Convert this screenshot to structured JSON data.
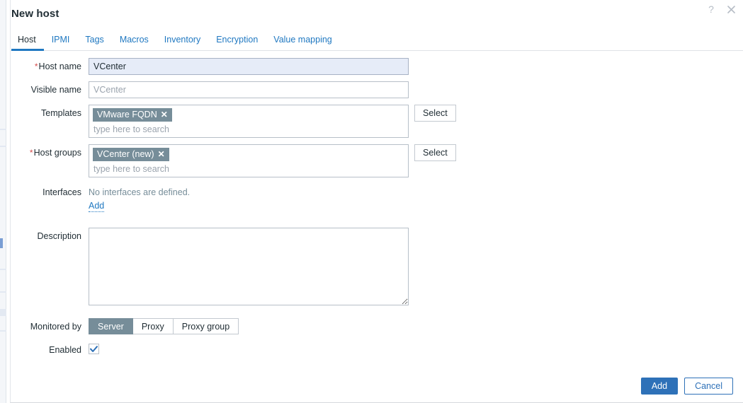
{
  "modal": {
    "title": "New host",
    "help_icon_label": "?",
    "close_icon_label": "×"
  },
  "tabs": [
    {
      "label": "Host",
      "active": true
    },
    {
      "label": "IPMI",
      "active": false
    },
    {
      "label": "Tags",
      "active": false
    },
    {
      "label": "Macros",
      "active": false
    },
    {
      "label": "Inventory",
      "active": false
    },
    {
      "label": "Encryption",
      "active": false
    },
    {
      "label": "Value mapping",
      "active": false
    }
  ],
  "form": {
    "host_name": {
      "label": "Host name",
      "required_marker": "*",
      "value": "VCenter"
    },
    "visible_name": {
      "label": "Visible name",
      "value": "",
      "placeholder": "VCenter"
    },
    "templates": {
      "label": "Templates",
      "chips": [
        {
          "text": "VMware FQDN",
          "remove": "✕"
        }
      ],
      "search_placeholder": "type here to search",
      "select_button": "Select"
    },
    "host_groups": {
      "label": "Host groups",
      "required_marker": "*",
      "chips": [
        {
          "text": "VCenter (new)",
          "remove": "✕"
        }
      ],
      "search_placeholder": "type here to search",
      "select_button": "Select"
    },
    "interfaces": {
      "label": "Interfaces",
      "empty_text": "No interfaces are defined.",
      "add_link": "Add"
    },
    "description": {
      "label": "Description",
      "value": "",
      "placeholder": ""
    },
    "monitored_by": {
      "label": "Monitored by",
      "options": [
        {
          "label": "Server",
          "selected": true
        },
        {
          "label": "Proxy",
          "selected": false
        },
        {
          "label": "Proxy group",
          "selected": false
        }
      ]
    },
    "enabled": {
      "label": "Enabled",
      "checked": true
    }
  },
  "footer": {
    "submit_label": "Add",
    "cancel_label": "Cancel"
  },
  "colors": {
    "accent_blue": "#1f78c1",
    "primary_button": "#2e71b8",
    "chip_slate": "#768d99",
    "required_red": "#d44b4b",
    "focused_field": "#e6ecf8"
  }
}
